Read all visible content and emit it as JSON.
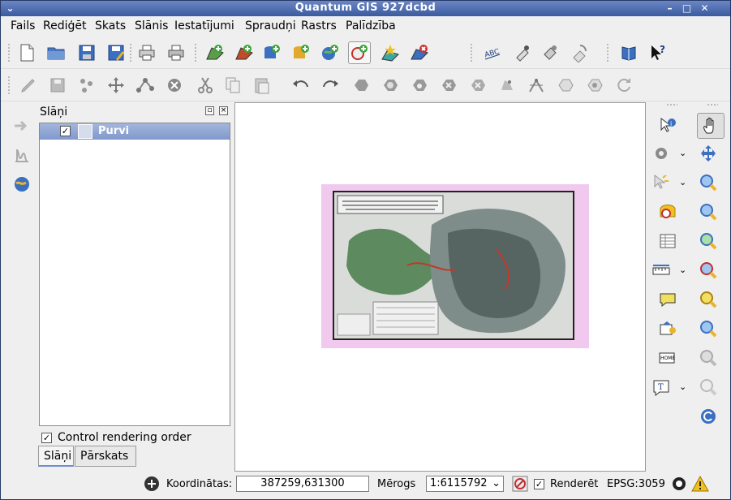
{
  "window": {
    "title": "Quantum GIS 927dcbd"
  },
  "menu": [
    "Fails",
    "Rediģēt",
    "Skats",
    "Slānis",
    "Iestatījumi",
    "Spraudņi",
    "Rastrs",
    "Palīdzība"
  ],
  "panel": {
    "title": "Slāņi",
    "layers": [
      {
        "name": "Purvi",
        "checked": true
      }
    ],
    "control_rendering_order": "Control rendering order",
    "tabs": [
      "Slāņi",
      "Pārskats"
    ]
  },
  "status": {
    "coords_label": "Koordinātas:",
    "coords_value": "387259,631300",
    "scale_label": "Mērogs",
    "scale_value": "1:6115792",
    "render_label": "Renderēt",
    "crs": "EPSG:3059"
  },
  "colors": {
    "titlebar": "#3b5a9f",
    "selection": "#7f98cc",
    "map_background": "#f1c8ee"
  }
}
